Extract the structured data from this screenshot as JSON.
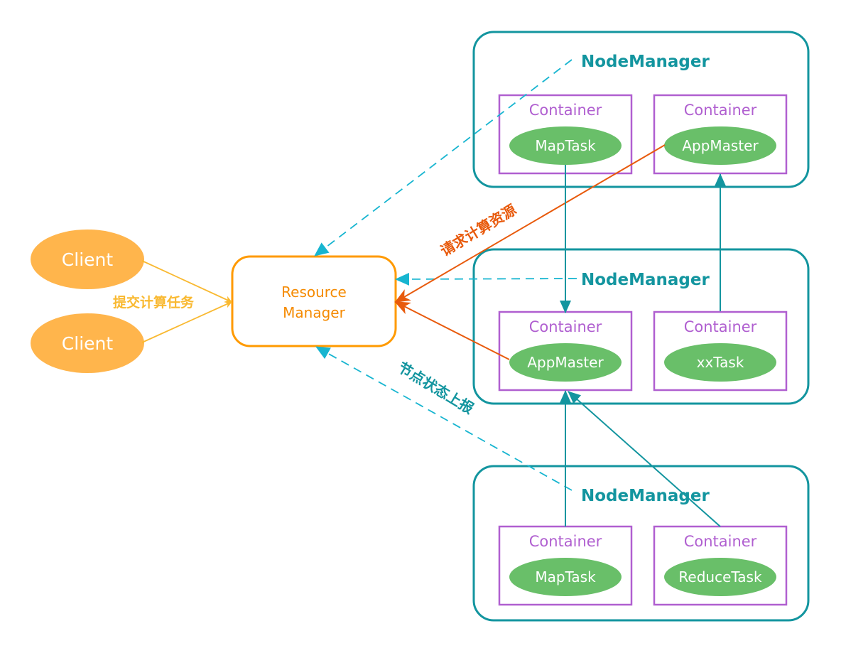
{
  "colors": {
    "client": "#ffb54c",
    "rm": "#ff9a00",
    "nodemanager": "#13959f",
    "container": "#b05fd0",
    "task": "#69bf69",
    "submit": "#f9b931",
    "request": "#e85a0c",
    "report": "#17b5d0"
  },
  "clients": [
    "Client",
    "Client"
  ],
  "resource_manager": {
    "line1": "Resource",
    "line2": "Manager"
  },
  "labels": {
    "submit": "提交计算任务",
    "request": "请求计算资源",
    "report": "节点状态上报"
  },
  "node_managers": [
    {
      "label": "NodeManager",
      "containers": [
        {
          "label": "Container",
          "task": "MapTask"
        },
        {
          "label": "Container",
          "task": "AppMaster"
        }
      ]
    },
    {
      "label": "NodeManager",
      "containers": [
        {
          "label": "Container",
          "task": "AppMaster"
        },
        {
          "label": "Container",
          "task": "xxTask"
        }
      ]
    },
    {
      "label": "NodeManager",
      "containers": [
        {
          "label": "Container",
          "task": "MapTask"
        },
        {
          "label": "Container",
          "task": "ReduceTask"
        }
      ]
    }
  ]
}
